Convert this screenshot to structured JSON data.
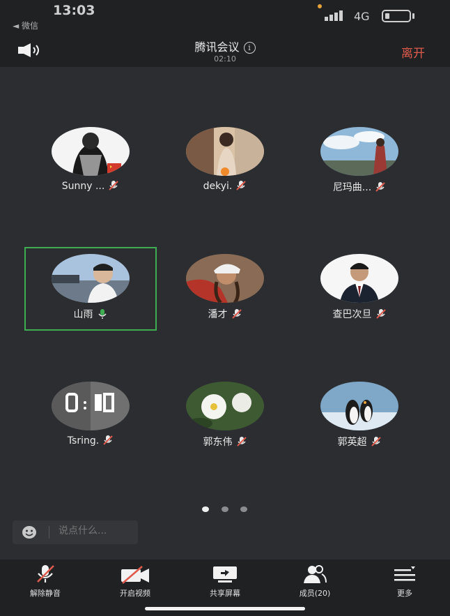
{
  "status_bar": {
    "time": "13:03",
    "back_app": "◄ 微信",
    "network": "4G"
  },
  "header": {
    "title": "腾讯会议",
    "timer": "02:10",
    "leave_label": "离开"
  },
  "participants": [
    {
      "name": "Sunny ...",
      "mic": "muted"
    },
    {
      "name": "dekyi.",
      "mic": "muted"
    },
    {
      "name": "尼玛曲...",
      "mic": "muted"
    },
    {
      "name": "山雨",
      "mic": "active",
      "speaking": true
    },
    {
      "name": "潘才",
      "mic": "muted"
    },
    {
      "name": "查巴次旦",
      "mic": "muted"
    },
    {
      "name": "Tsring.",
      "mic": "muted"
    },
    {
      "name": "郭东伟",
      "mic": "muted"
    },
    {
      "name": "郭英超",
      "mic": "muted"
    }
  ],
  "pagination": {
    "pages": 3,
    "current": 1
  },
  "chat": {
    "placeholder": "说点什么..."
  },
  "toolbar": {
    "unmute_label": "解除静音",
    "video_label": "开启视频",
    "share_label": "共享屏幕",
    "members_label": "成员(20)",
    "more_label": "更多"
  },
  "colors": {
    "accent_green": "#3fae52",
    "leave_red": "#e05a4e",
    "muted_red": "#e05a4e"
  }
}
